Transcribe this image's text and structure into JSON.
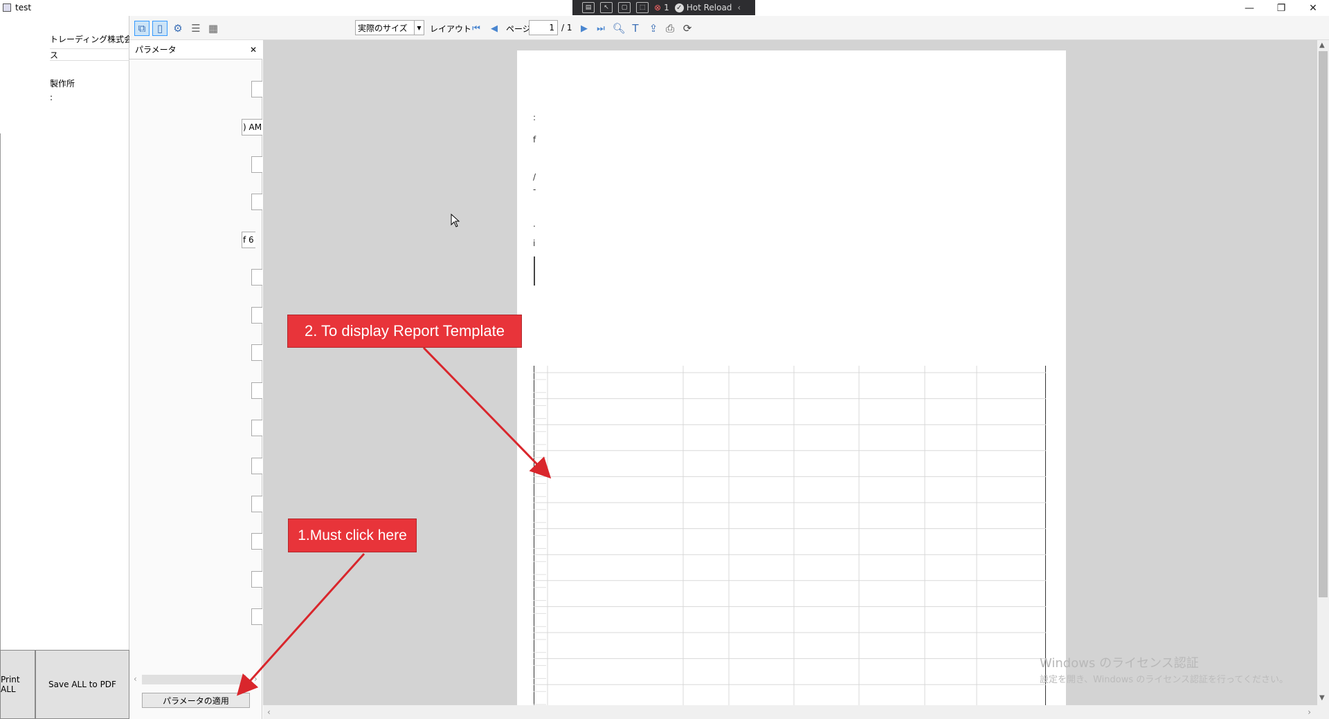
{
  "window": {
    "title": "test",
    "minimize_glyph": "—",
    "restore_glyph": "❐",
    "close_glyph": "✕"
  },
  "hot_reload_toolbar": {
    "hot_reload_label": "Hot Reload",
    "counter_label": "1"
  },
  "left_panel": {
    "row1": "トレーディング株式会社",
    "row2": "ス",
    "row3": "製作所",
    "row4": ":",
    "print_all_label": "Print ALL",
    "save_pdf_label": "Save ALL to PDF"
  },
  "viewer_toolbar": {
    "zoom_value": "実際のサイズ",
    "layout_label": "レイアウト",
    "page_label": "ページ",
    "page_current": "1",
    "page_total": "/ 1"
  },
  "parameters": {
    "header": "パラメータ",
    "close_glyph": "✕",
    "field_time": ") AM",
    "field_six": "f 6",
    "apply_label": "パラメータの適用"
  },
  "report_page": {
    "fragments": [
      ":",
      "f",
      "/",
      "-",
      ".",
      "i"
    ]
  },
  "annotations": {
    "callout_1": "1.Must click here",
    "callout_2": "2. To display Report Template",
    "arrow_color": "#d9262c"
  },
  "watermark": {
    "line1": "Windows のライセンス認証",
    "line2": "設定を開き、Windows のライセンス認証を行ってください。"
  },
  "colors": {
    "callout_bg": "#e8343a",
    "viewport_bg": "#d3d3d3",
    "toolbar_icon": "#3b6fb6"
  }
}
